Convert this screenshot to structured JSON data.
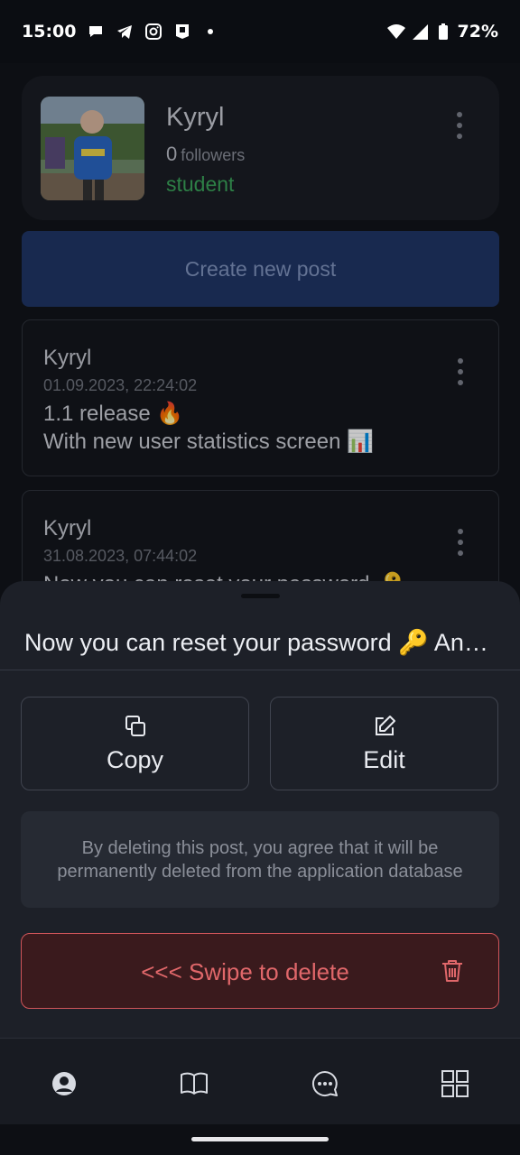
{
  "status_bar": {
    "time": "15:00",
    "battery": "72%",
    "notification_icons": [
      "chat-bubble-icon",
      "telegram-icon",
      "instagram-icon",
      "app-icon"
    ],
    "system_icons": [
      "wifi-icon",
      "signal-icon",
      "battery-icon"
    ]
  },
  "profile": {
    "name": "Kyryl",
    "followers_count": "0",
    "followers_label": "followers",
    "role": "student"
  },
  "create_post": {
    "label": "Create new post"
  },
  "posts": [
    {
      "author": "Kyryl",
      "date": "01.09.2023, 22:24:02",
      "text": "1.1 release 🔥\nWith new user statistics screen 📊"
    },
    {
      "author": "Kyryl",
      "date": "31.08.2023, 07:44:02",
      "text": "Now you can reset your password 🔑"
    }
  ],
  "sheet": {
    "title": "Now you can reset your password 🔑 An…",
    "copy_label": "Copy",
    "edit_label": "Edit",
    "notice": "By deleting this post, you agree that it will be permanently deleted from the application database",
    "swipe_label": "<<< Swipe to delete"
  },
  "bottom_nav": {
    "items": [
      "profile-icon",
      "book-icon",
      "chat-icon",
      "grid-icon"
    ]
  },
  "colors": {
    "background": "#11141a",
    "card": "#1a1d24",
    "primary_button": "#1f3566",
    "role_green": "#3aa35a",
    "danger": "#e0676a",
    "danger_bg": "#3a1a1d"
  }
}
